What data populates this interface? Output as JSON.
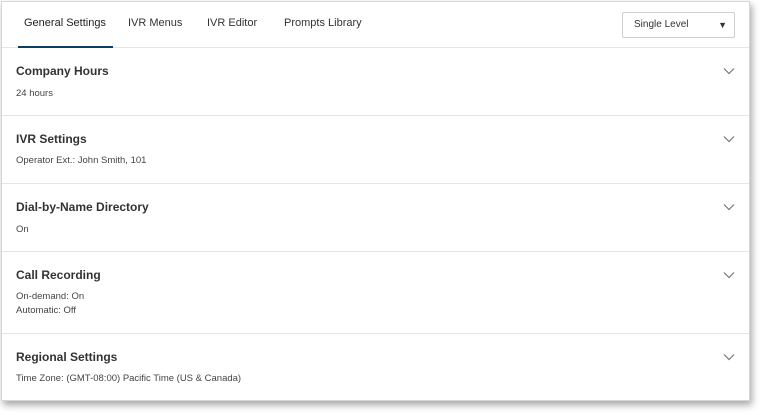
{
  "tabs": [
    {
      "label": "General Settings",
      "active": true
    },
    {
      "label": "IVR Menus",
      "active": false
    },
    {
      "label": "IVR Editor",
      "active": false
    },
    {
      "label": "Prompts Library",
      "active": false
    }
  ],
  "level_select": {
    "value": "Single Level",
    "caret": "▼"
  },
  "sections": [
    {
      "title": "Company Hours",
      "lines": [
        "24 hours"
      ],
      "icon": "chevron-down-icon"
    },
    {
      "title": "IVR Settings",
      "lines": [
        "Operator Ext.: John Smith, 101"
      ],
      "icon": "chevron-down-icon"
    },
    {
      "title": "Dial-by-Name Directory",
      "lines": [
        "On"
      ],
      "icon": "chevron-down-icon"
    },
    {
      "title": "Call Recording",
      "lines": [
        "On-demand: On",
        "Automatic: Off"
      ],
      "icon": "chevron-down-icon"
    },
    {
      "title": "Regional Settings",
      "lines": [
        "Time Zone: (GMT-08:00) Pacific Time (US & Canada)"
      ],
      "icon": "chevron-down-icon"
    }
  ],
  "colors": {
    "active_tab_underline": "#0a3d62",
    "divider": "#e4e4e4",
    "text": "#333333"
  }
}
